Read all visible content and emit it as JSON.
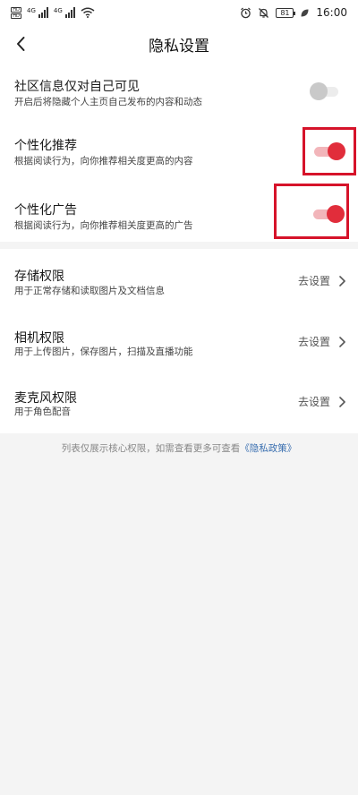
{
  "status_bar": {
    "sim1": "HD",
    "sim2": "HD",
    "net1": "4G",
    "net2": "4G",
    "battery": "81",
    "time": "16:00"
  },
  "nav": {
    "title": "隐私设置"
  },
  "settings": {
    "community_visible": {
      "title": "社区信息仅对自己可见",
      "desc": "开启后将隐藏个人主页自己发布的内容和动态",
      "enabled": false
    },
    "personalized_recommend": {
      "title": "个性化推荐",
      "desc": "根据阅读行为，向你推荐相关度更高的内容",
      "enabled": true
    },
    "personalized_ads": {
      "title": "个性化广告",
      "desc": "根据阅读行为，向你推荐相关度更高的广告",
      "enabled": true
    }
  },
  "permissions": {
    "storage": {
      "title": "存储权限",
      "desc": "用于正常存储和读取图片及文档信息",
      "action": "去设置"
    },
    "camera": {
      "title": "相机权限",
      "desc": "用于上传图片，保存图片，扫描及直播功能",
      "action": "去设置"
    },
    "microphone": {
      "title": "麦克风权限",
      "desc": "用于角色配音",
      "action": "去设置"
    }
  },
  "footer": {
    "note": "列表仅展示核心权限，如需查看更多可查看",
    "policy_link": "《隐私政策》"
  },
  "colors": {
    "accent": "#e12d3b",
    "accent_track": "#f2b5ba",
    "highlight_border": "#d6132a",
    "link": "#3a6fb0"
  }
}
